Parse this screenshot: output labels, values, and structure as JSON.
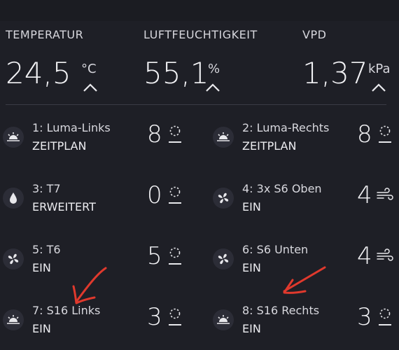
{
  "metrics": [
    {
      "label": "TEMPERATUR",
      "value": "24,5",
      "unit": "°C",
      "chevron_icon": "chevron-up-icon"
    },
    {
      "label": "LUFTFEUCHTIGKEIT",
      "value": "55,1",
      "unit": "%",
      "chevron_icon": "chevron-up-icon"
    },
    {
      "label": "VPD",
      "value": "1,37",
      "unit": "kPa",
      "chevron_icon": "chevron-up-icon"
    }
  ],
  "channels": [
    {
      "name": "1: Luma-Links",
      "mode": "ZEITPLAN",
      "value": "8",
      "icon": "sunrise-icon",
      "status_icon": "dashed-circle-icon"
    },
    {
      "name": "2: Luma-Rechts",
      "mode": "ZEITPLAN",
      "value": "8",
      "icon": "sunrise-icon",
      "status_icon": "dashed-circle-icon"
    },
    {
      "name": "3: T7",
      "mode": "ERWEITERT",
      "value": "0",
      "icon": "water-drop-icon",
      "status_icon": "dashed-circle-icon"
    },
    {
      "name": "4: 3x S6 Oben",
      "mode": "EIN",
      "value": "4",
      "icon": "fan-icon",
      "status_icon": "wind-icon"
    },
    {
      "name": "5: T6",
      "mode": "EIN",
      "value": "5",
      "icon": "fan-icon",
      "status_icon": "dashed-circle-icon"
    },
    {
      "name": "6: S6 Unten",
      "mode": "EIN",
      "value": "4",
      "icon": "fan-icon",
      "status_icon": "wind-icon"
    },
    {
      "name": "7: S16 Links",
      "mode": "EIN",
      "value": "3",
      "icon": "sunrise-icon",
      "status_icon": "dashed-circle-icon"
    },
    {
      "name": "8: S16 Rechts",
      "mode": "EIN",
      "value": "3",
      "icon": "sunrise-icon",
      "status_icon": "dashed-circle-icon"
    }
  ],
  "colors": {
    "background": "#1e1f26",
    "icon_bg": "#2c2d37",
    "text": "#e8e8ec",
    "annotation_red": "#e0392d"
  }
}
